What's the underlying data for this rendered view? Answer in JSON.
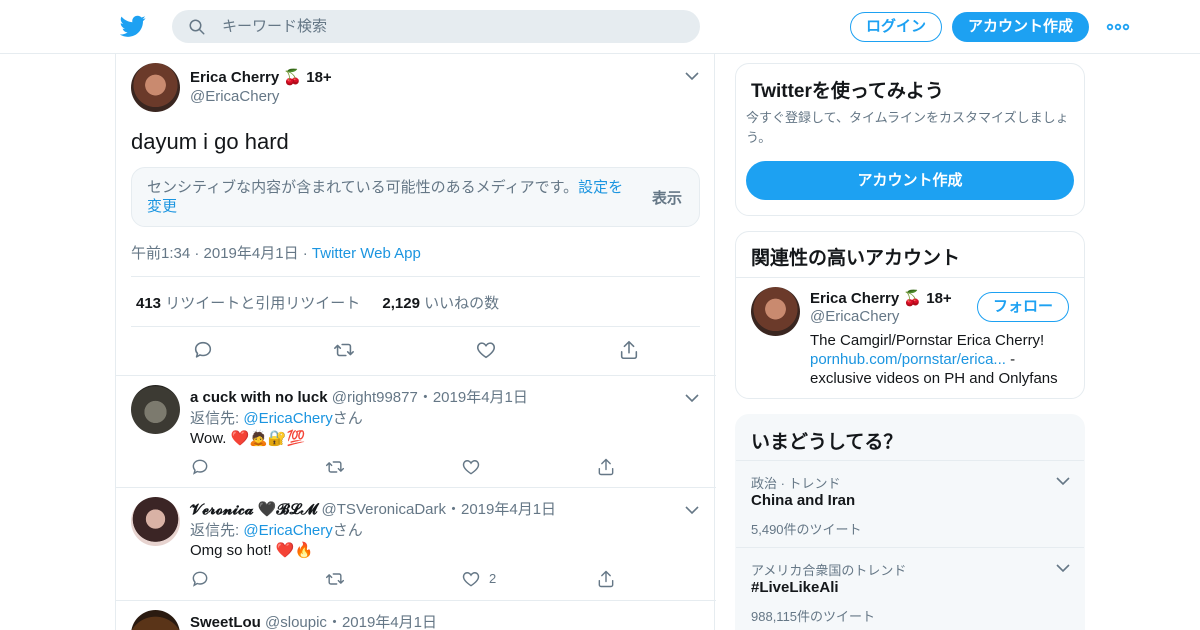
{
  "header": {
    "search_placeholder": "キーワード検索",
    "login_label": "ログイン",
    "signup_label": "アカウント作成"
  },
  "main_tweet": {
    "name": "Erica Cherry 🍒 18+",
    "handle": "@EricaChery",
    "text": "dayum i go hard",
    "sensitive_text": "センシティブな内容が含まれている可能性のあるメディアです。",
    "sensitive_link": "設定を変更",
    "sensitive_show": "表示",
    "time": "午前1:34 · 2019年4月1日 · ",
    "app": "Twitter Web App",
    "retweets": "413",
    "retweets_label": " リツイートと引用リツイート",
    "likes": "2,129",
    "likes_label": " いいねの数"
  },
  "replies": [
    {
      "name": "a cuck with no luck",
      "handle": "@right99877",
      "date": "・2019年4月1日",
      "reply_prefix": "返信先: ",
      "reply_to": "@EricaChery",
      "reply_suffix": "さん",
      "text": "Wow. ❤️🙇🔐💯",
      "likes": ""
    },
    {
      "name": "𝓥𝓮𝓻𝓸𝓷𝓲𝓬𝓪 🖤𝓑𝓛𝓜",
      "handle": "@TSVeronicaDark",
      "date": "・2019年4月1日",
      "reply_prefix": "返信先: ",
      "reply_to": "@EricaChery",
      "reply_suffix": "さん",
      "text": "Omg so hot! ❤️🔥",
      "likes": "2"
    },
    {
      "name": "SweetLou",
      "handle": "@sloupic",
      "date": "・2019年4月1日"
    }
  ],
  "sidebar": {
    "signup_title": "Twitterを使ってみよう",
    "signup_desc": "今すぐ登録して、タイムラインをカスタマイズしましょう。",
    "signup_button": "アカウント作成",
    "related_title": "関連性の高いアカウント",
    "related_name": "Erica Cherry 🍒 18+",
    "related_handle": "@EricaChery",
    "follow_label": "フォロー",
    "bio_1": "The Camgirl/Pornstar Erica Cherry! ",
    "bio_link": "pornhub.com/pornstar/erica...",
    "bio_2": " - exclusive videos on PH and Onlyfans",
    "trends_title": "いまどうしてる？",
    "trends": [
      {
        "meta": "政治 · トレンド",
        "name": "China and Iran",
        "count": "5,490件のツイート"
      },
      {
        "meta": "アメリカ合衆国のトレンド",
        "name": "#LiveLikeAli",
        "count": "988,115件のツイート"
      }
    ]
  },
  "colors": {
    "accent": "#1da1f2",
    "link": "#1b95e0",
    "muted": "#657786",
    "border": "#e6ecf0"
  }
}
